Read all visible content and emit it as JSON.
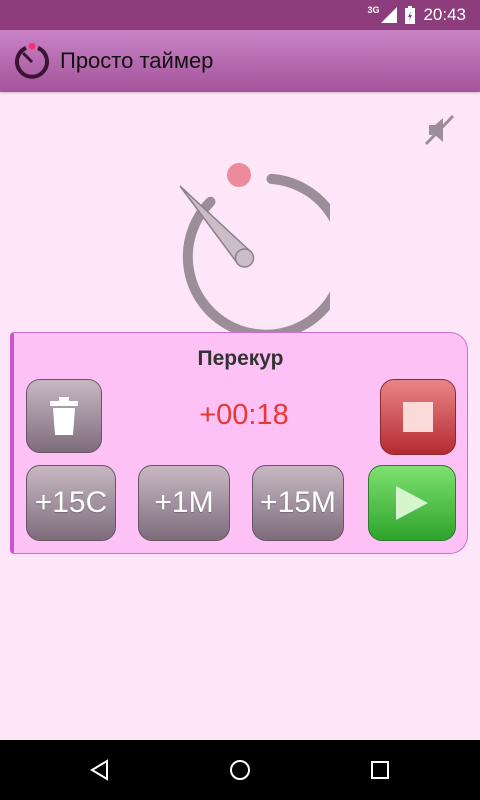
{
  "status_bar": {
    "network": "3G",
    "time": "20:43"
  },
  "app_bar": {
    "title": "Просто таймер"
  },
  "timer": {
    "name": "Перекур",
    "elapsed": "+00:18",
    "buttons": {
      "add_15s": "+15С",
      "add_1m": "+1М",
      "add_15m": "+15М"
    }
  },
  "icons": [
    "app-logo-icon",
    "mute-icon",
    "trash-icon",
    "stop-icon",
    "play-icon",
    "back-icon",
    "home-icon",
    "recents-icon"
  ],
  "colors": {
    "primary": "#a4549a",
    "background": "#fde6f8",
    "card": "#fdc1f6",
    "counter": "#e53935",
    "stop": "#c94046",
    "play": "#3fb73b"
  }
}
